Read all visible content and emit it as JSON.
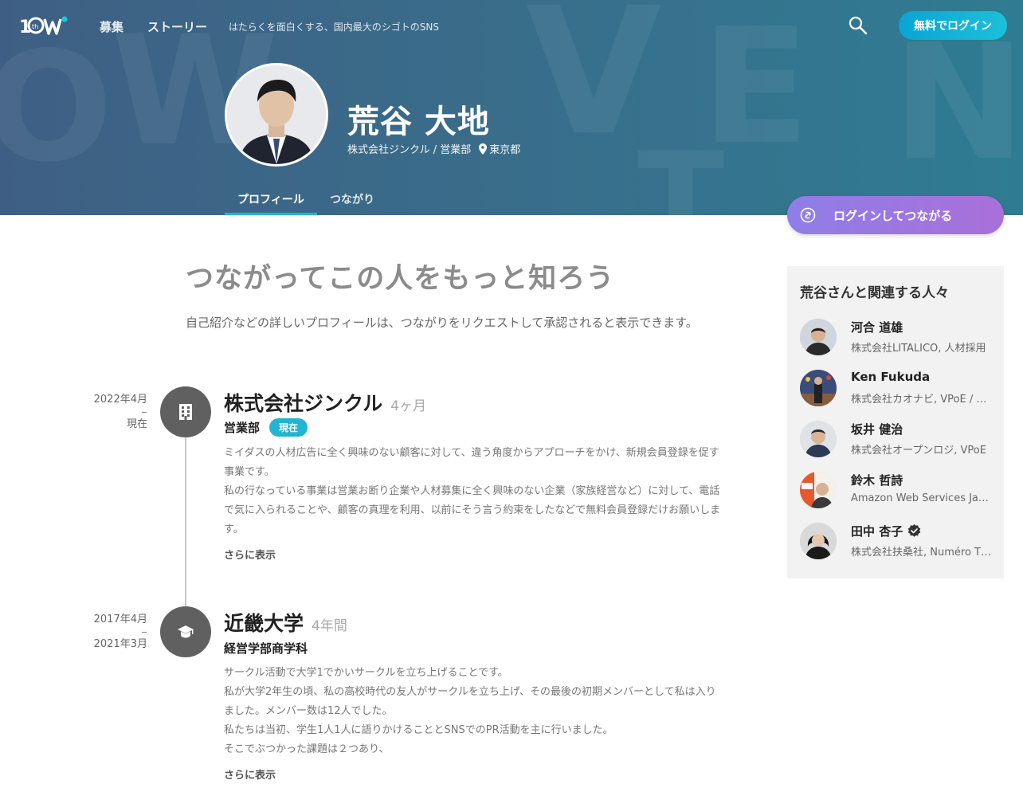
{
  "header": {
    "nav": [
      "募集",
      "ストーリー"
    ],
    "tagline": "はたらくを面白くする、国内最大のシゴトのSNS",
    "login_label": "無料でログイン"
  },
  "profile": {
    "name": "荒谷 大地",
    "company_role": "株式会社ジンクル / 営業部",
    "location": "東京都",
    "tabs": [
      "プロフィール",
      "つながり"
    ],
    "connect_label": "ログインしてつながる"
  },
  "main": {
    "headline": "つながってこの人をもっと知ろう",
    "subline": "自己紹介などの詳しいプロフィールは、つながりをリクエストして承認されると表示できます。"
  },
  "timeline": [
    {
      "start": "2022年4月",
      "end": "現在",
      "org": "株式会社ジンクル",
      "duration": "4ヶ月",
      "role": "営業部",
      "badge": "現在",
      "lines": [
        "ミイダスの人材広告に全く興味のない顧客に対して、違う角度からアプローチをかけ、新規会員登録を促す",
        "事業です。",
        "私の行なっている事業は営業お断り企業や人材募集に全く興味のない企業（家族経営など）に対して、電話",
        "で気に入られることや、顧客の真理を利用、以前にそう言う約束をしたなどで無料会員登録だけお願いしま",
        "す。"
      ],
      "more": "さらに表示"
    },
    {
      "start": "2017年4月",
      "end": "2021年3月",
      "org": "近畿大学",
      "duration": "4年間",
      "role": "経営学部商学科",
      "lines": [
        "サークル活動で大学1でかいサークルを立ち上げることです。",
        "私が大学2年生の頃、私の高校時代の友人がサークルを立ち上げ、その最後の初期メンバーとして私は入り",
        "ました。メンバー数は12人でした。",
        "私たちは当初、学生1人1人に語りかけることとSNSでのPR活動を主に行いました。",
        "そこでぶつかった課題は２つあり、"
      ],
      "more": "さらに表示"
    }
  ],
  "sidebar": {
    "title": "荒谷さんと関連する人々",
    "people": [
      {
        "name": "河合 道雄",
        "desc": "株式会社LITALICO, 人材採用"
      },
      {
        "name": "Ken Fukuda",
        "desc": "株式会社カオナビ, VPoE / 開発"
      },
      {
        "name": "坂井 健治",
        "desc": "株式会社オープンロジ, VPoE"
      },
      {
        "name": "鈴木 哲詩",
        "desc": "Amazon Web Services Japan"
      },
      {
        "name": "田中 杏子",
        "desc": "株式会社扶桑社, Numéro TOKYO",
        "verified": true
      }
    ]
  },
  "colors": {
    "accent": "#1cb8d6",
    "connect_gradient_start": "#8f7ee8",
    "connect_gradient_end": "#a96fd9",
    "hero_bg": "#3a6c8a"
  }
}
